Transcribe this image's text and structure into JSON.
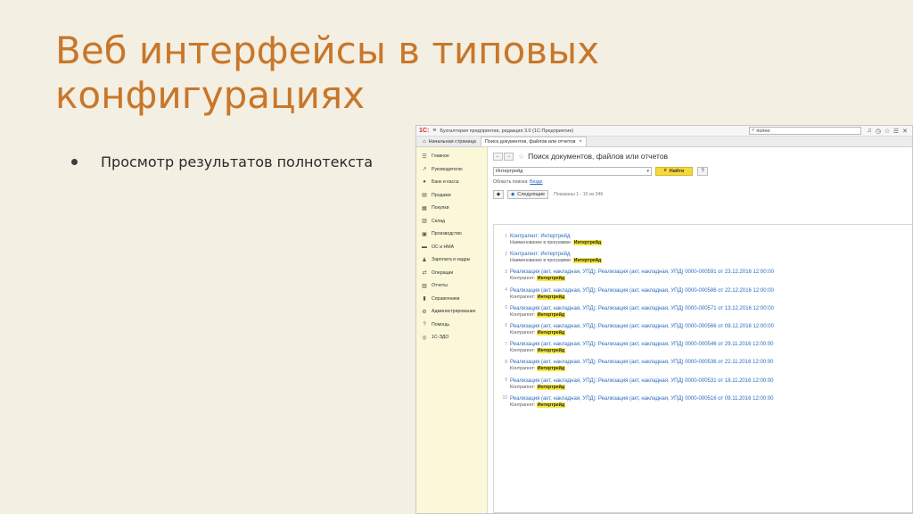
{
  "slide": {
    "title": "Веб интерфейсы в типовых конфигурациях",
    "bullet": "Просмотр результатов полнотекста"
  },
  "window": {
    "logo": "1С:",
    "title": "Бухгалтерия предприятия, редакция 3.0  (1С:Предприятие)",
    "search_value": "полно",
    "tabs": [
      {
        "label": "Начальная страница"
      },
      {
        "label": "Поиск документов, файлов или отчетов"
      }
    ]
  },
  "sidebar": {
    "items": [
      {
        "label": "Главное",
        "icon": "☰"
      },
      {
        "label": "Руководителю",
        "icon": "↗"
      },
      {
        "label": "Банк и касса",
        "icon": "●"
      },
      {
        "label": "Продажи",
        "icon": "▤"
      },
      {
        "label": "Покупки",
        "icon": "▦"
      },
      {
        "label": "Склад",
        "icon": "▥"
      },
      {
        "label": "Производство",
        "icon": "▣"
      },
      {
        "label": "ОС и НМА",
        "icon": "▬"
      },
      {
        "label": "Зарплата и кадры",
        "icon": "♟"
      },
      {
        "label": "Операции",
        "icon": "⇄"
      },
      {
        "label": "Отчеты",
        "icon": "▧"
      },
      {
        "label": "Справочники",
        "icon": "▮"
      },
      {
        "label": "Администрирование",
        "icon": "⚙"
      },
      {
        "label": "Помощь",
        "icon": "?"
      },
      {
        "label": "1С-ЭДО",
        "icon": "◎"
      }
    ]
  },
  "form": {
    "title": "Поиск документов, файлов или отчетов",
    "query": "Интертрейд",
    "find_label": "Найти",
    "help_label": "?",
    "scope_label": "Область поиска:",
    "scope_value": "Везде",
    "next_label": "Следующие",
    "shown_label": "Показаны 1 - 10 из 346"
  },
  "results": [
    {
      "num": "1",
      "title": "Контрагент: Интертрейд",
      "sub_label": "Наименование в программе:",
      "sub_value": "Интертрейд"
    },
    {
      "num": "2",
      "title": "Контрагент: Интертрейд",
      "sub_label": "Наименование в программе:",
      "sub_value": "Интертрейд"
    },
    {
      "num": "3",
      "title": "Реализация (акт, накладная, УПД): Реализация (акт, накладная, УПД) 0000-000591 от 23.12.2016 12:00:00",
      "sub_label": "Контрагент:",
      "sub_value": "Интертрейд"
    },
    {
      "num": "4",
      "title": "Реализация (акт, накладная, УПД): Реализация (акт, накладная, УПД) 0000-000586 от 22.12.2016 12:00:00",
      "sub_label": "Контрагент:",
      "sub_value": "Интертрейд"
    },
    {
      "num": "5",
      "title": "Реализация (акт, накладная, УПД): Реализация (акт, накладная, УПД) 0000-000571 от 13.12.2016 12:00:00",
      "sub_label": "Контрагент:",
      "sub_value": "Интертрейд"
    },
    {
      "num": "6",
      "title": "Реализация (акт, накладная, УПД): Реализация (акт, накладная, УПД) 0000-000566 от 09.12.2016 12:00:00",
      "sub_label": "Контрагент:",
      "sub_value": "Интертрейд"
    },
    {
      "num": "7",
      "title": "Реализация (акт, накладная, УПД): Реализация (акт, накладная, УПД) 0000-000546 от 29.11.2016 12:00:00",
      "sub_label": "Контрагент:",
      "sub_value": "Интертрейд"
    },
    {
      "num": "8",
      "title": "Реализация (акт, накладная, УПД): Реализация (акт, накладная, УПД) 0000-000536 от 22.11.2016 12:00:00",
      "sub_label": "Контрагент:",
      "sub_value": "Интертрейд"
    },
    {
      "num": "9",
      "title": "Реализация (акт, накладная, УПД): Реализация (акт, накладная, УПД) 0000-000531 от 18.11.2016 12:00:00",
      "sub_label": "Контрагент:",
      "sub_value": "Интертрейд"
    },
    {
      "num": "10",
      "title": "Реализация (акт, накладная, УПД): Реализация (акт, накладная, УПД) 0000-000516 от 09.11.2016 12:00:00",
      "sub_label": "Контрагент:",
      "sub_value": "Интертрейд"
    }
  ]
}
